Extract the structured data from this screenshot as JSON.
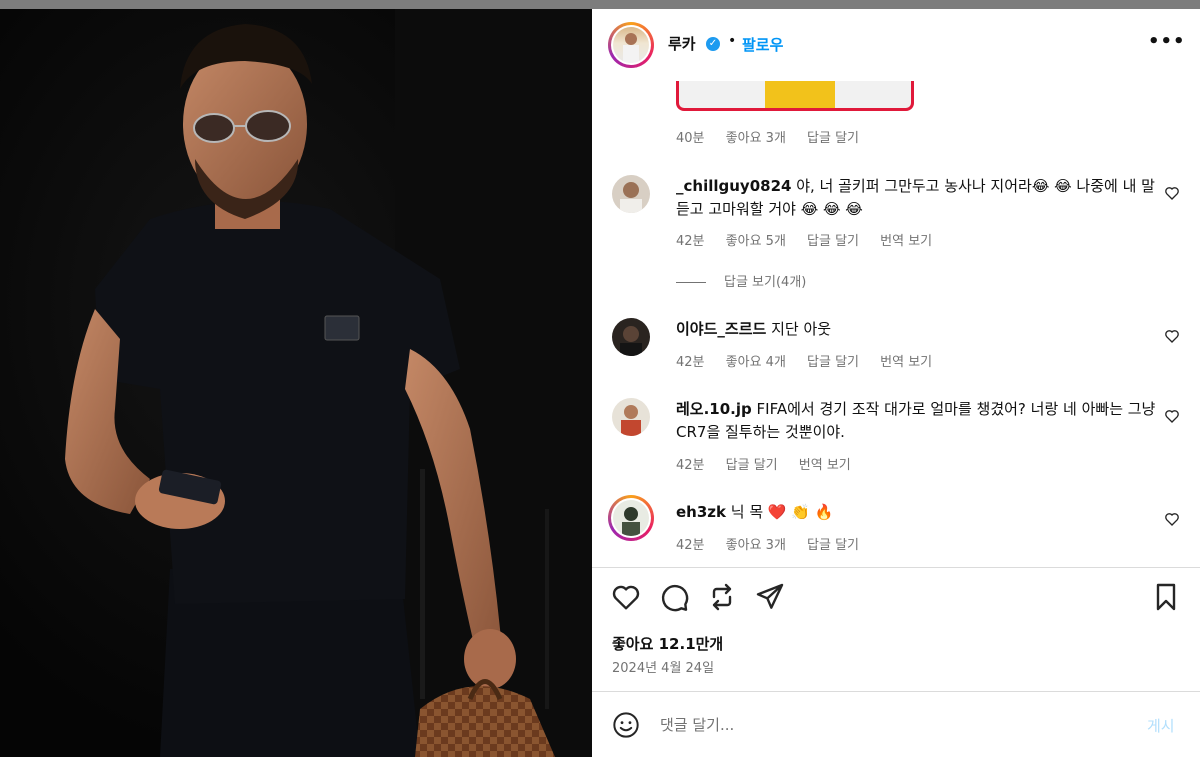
{
  "header": {
    "username": "루카",
    "verified_mark": "✓",
    "separator": "•",
    "follow_label": "팔로우",
    "more_label": "•••"
  },
  "comments": [
    {
      "meta": {
        "time": "40분",
        "likes": "좋아요 3개",
        "reply": "답글 달기"
      }
    },
    {
      "user": "_chillguy0824",
      "text": " 야, 너 골키퍼 그만두고 농사나 지어라😂 😂 나중에 내 말 듣고 고마워할 거야 😂 😂 😂",
      "meta": {
        "time": "42분",
        "likes": "좋아요 5개",
        "reply": "답글 달기",
        "translate": "번역 보기"
      },
      "view_replies": "답글 보기(4개)"
    },
    {
      "user": "이야드_즈르드",
      "text": " 지단 아웃",
      "meta": {
        "time": "42분",
        "likes": "좋아요 4개",
        "reply": "답글 달기",
        "translate": "번역 보기"
      }
    },
    {
      "user": "레오.10.jp",
      "text": " FIFA에서 경기 조작 대가로 얼마를 챙겼어? 너랑 네 아빠는 그냥 CR7을 질투하는 것뿐이야.",
      "meta": {
        "time": "42분",
        "reply": "답글 달기",
        "translate": "번역 보기"
      }
    },
    {
      "user": "eh3zk",
      "text": " 닉 목 ❤️ 👏 🔥",
      "meta": {
        "time": "42분",
        "likes": "좋아요 3개",
        "reply": "답글 달기"
      }
    }
  ],
  "post": {
    "likes": "좋아요 12.1만개",
    "date": "2024년 4월 24일"
  },
  "comment_box": {
    "placeholder": "댓글 달기...",
    "post_label": "게시"
  },
  "colors": {
    "accent": "#0095f6",
    "muted": "#737373",
    "post_disabled": "#b2dffc"
  }
}
